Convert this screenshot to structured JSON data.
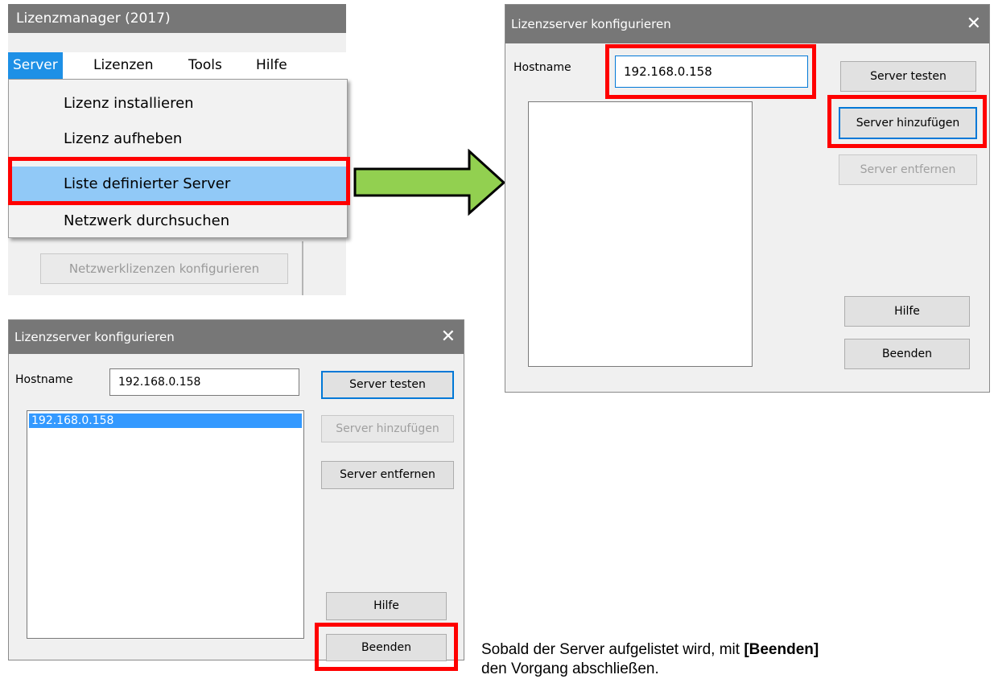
{
  "main_window": {
    "title": "Lizenzmanager (2017)",
    "menu": [
      "Server",
      "Lizenzen",
      "Tools",
      "Hilfe"
    ],
    "dropdown_items": [
      "Lizenz installieren",
      "Lizenz aufheben",
      "Liste definierter Server",
      "Netzwerk durchsuchen"
    ],
    "network_button": "Netzwerklizenzen konfigurieren"
  },
  "arrow": {
    "fill": "#92d050",
    "outline": "#000000"
  },
  "highlight_color": "#ff0000",
  "dialog_before": {
    "title": "Lizenzserver konfigurieren",
    "close": "✕",
    "hostname_label": "Hostname",
    "hostname_value": "192.168.0.158",
    "buttons": {
      "test": "Server testen",
      "add": "Server hinzufügen",
      "remove": "Server entfernen",
      "help": "Hilfe",
      "exit": "Beenden"
    }
  },
  "dialog_after": {
    "title": "Lizenzserver konfigurieren",
    "close": "✕",
    "hostname_label": "Hostname",
    "hostname_value": "192.168.0.158",
    "list_items": [
      "192.168.0.158"
    ],
    "buttons": {
      "test": "Server testen",
      "add": "Server hinzufügen",
      "remove": "Server entfernen",
      "help": "Hilfe",
      "exit": "Beenden"
    }
  },
  "caption": {
    "part1": "Sobald der Server aufgelistet wird, mit ",
    "bold": "[Beenden]",
    "part2": "den Vorgang abschließen."
  }
}
